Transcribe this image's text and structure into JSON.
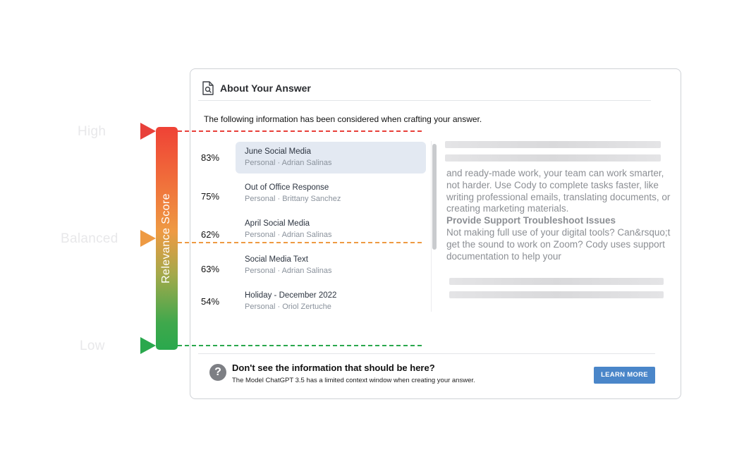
{
  "relevance_scale": {
    "levels": [
      {
        "label": "High",
        "color": "#e8403a"
      },
      {
        "label": "Balanced",
        "color": "#ee9a43"
      },
      {
        "label": "Low",
        "color": "#2aa84d"
      }
    ],
    "bar_label": "Relevance Score"
  },
  "panel": {
    "title": "About Your Answer",
    "title_icon": "document-search-icon",
    "intro": "The following information has been considered when crafting your answer.",
    "sources": [
      {
        "percent": "83%",
        "title": "June Social Media",
        "subtitle": "Personal · Adrian Salinas",
        "selected": true
      },
      {
        "percent": "75%",
        "title": "Out of Office Response",
        "subtitle": "Personal · Brittany Sanchez",
        "selected": false
      },
      {
        "percent": "62%",
        "title": "April Social Media",
        "subtitle": "Personal · Adrian Salinas",
        "selected": false
      },
      {
        "percent": "63%",
        "title": "Social Media Text",
        "subtitle": "Personal · Adrian Salinas",
        "selected": false
      },
      {
        "percent": "54%",
        "title": "Holiday - December 2022",
        "subtitle": "Personal · Oriol Zertuche",
        "selected": false
      }
    ],
    "preview": {
      "paragraph_1": " and ready-made work, your team can work smarter, not harder. Use Cody to complete tasks faster, like writing professional emails, translating documents, or creating marketing materials.",
      "heading": "Provide Support Troubleshoot Issues",
      "paragraph_2": "Not making full use of your digital tools? Can&rsquo;t get the sound to work on Zoom? Cody uses support documentation to help your"
    },
    "footer": {
      "help_icon": "question-circle-icon",
      "title": "Don't see the information that should be here?",
      "text": "The Model ChatGPT 3.5 has a limited context window when creating your answer.",
      "button_label": "LEARN MORE",
      "button_color": "#4a86c9"
    }
  }
}
